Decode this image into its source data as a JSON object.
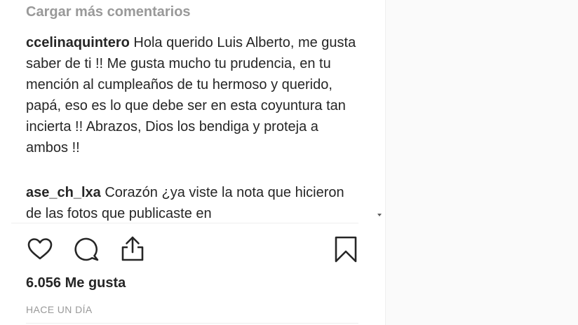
{
  "comments_section": {
    "load_more_label": "Cargar más comentarios",
    "items": [
      {
        "username": "ccelinaquintero",
        "text": "Hola querido Luis Alberto, me gusta saber de ti !! Me gusta mucho tu prudencia, en tu mención al cumpleaños de tu hermoso y querido, papá, eso es lo que debe ser en esta coyuntura tan incierta !! Abrazos, Dios los bendiga y proteja a ambos !!"
      },
      {
        "username": "ase_ch_lxa",
        "text": "Corazón ¿ya viste la nota que hicieron de las fotos que publicaste en"
      }
    ]
  },
  "actions": {
    "like_icon": "heart-outline-icon",
    "comment_icon": "speech-bubble-icon",
    "share_icon": "share-upload-icon",
    "save_icon": "bookmark-outline-icon"
  },
  "post_meta": {
    "likes_label": "6.056 Me gusta",
    "timestamp": "HACE UN DÍA"
  },
  "colors": {
    "text": "#262626",
    "muted": "#999999",
    "divider": "#efefef",
    "side_background": "#fafafa"
  }
}
